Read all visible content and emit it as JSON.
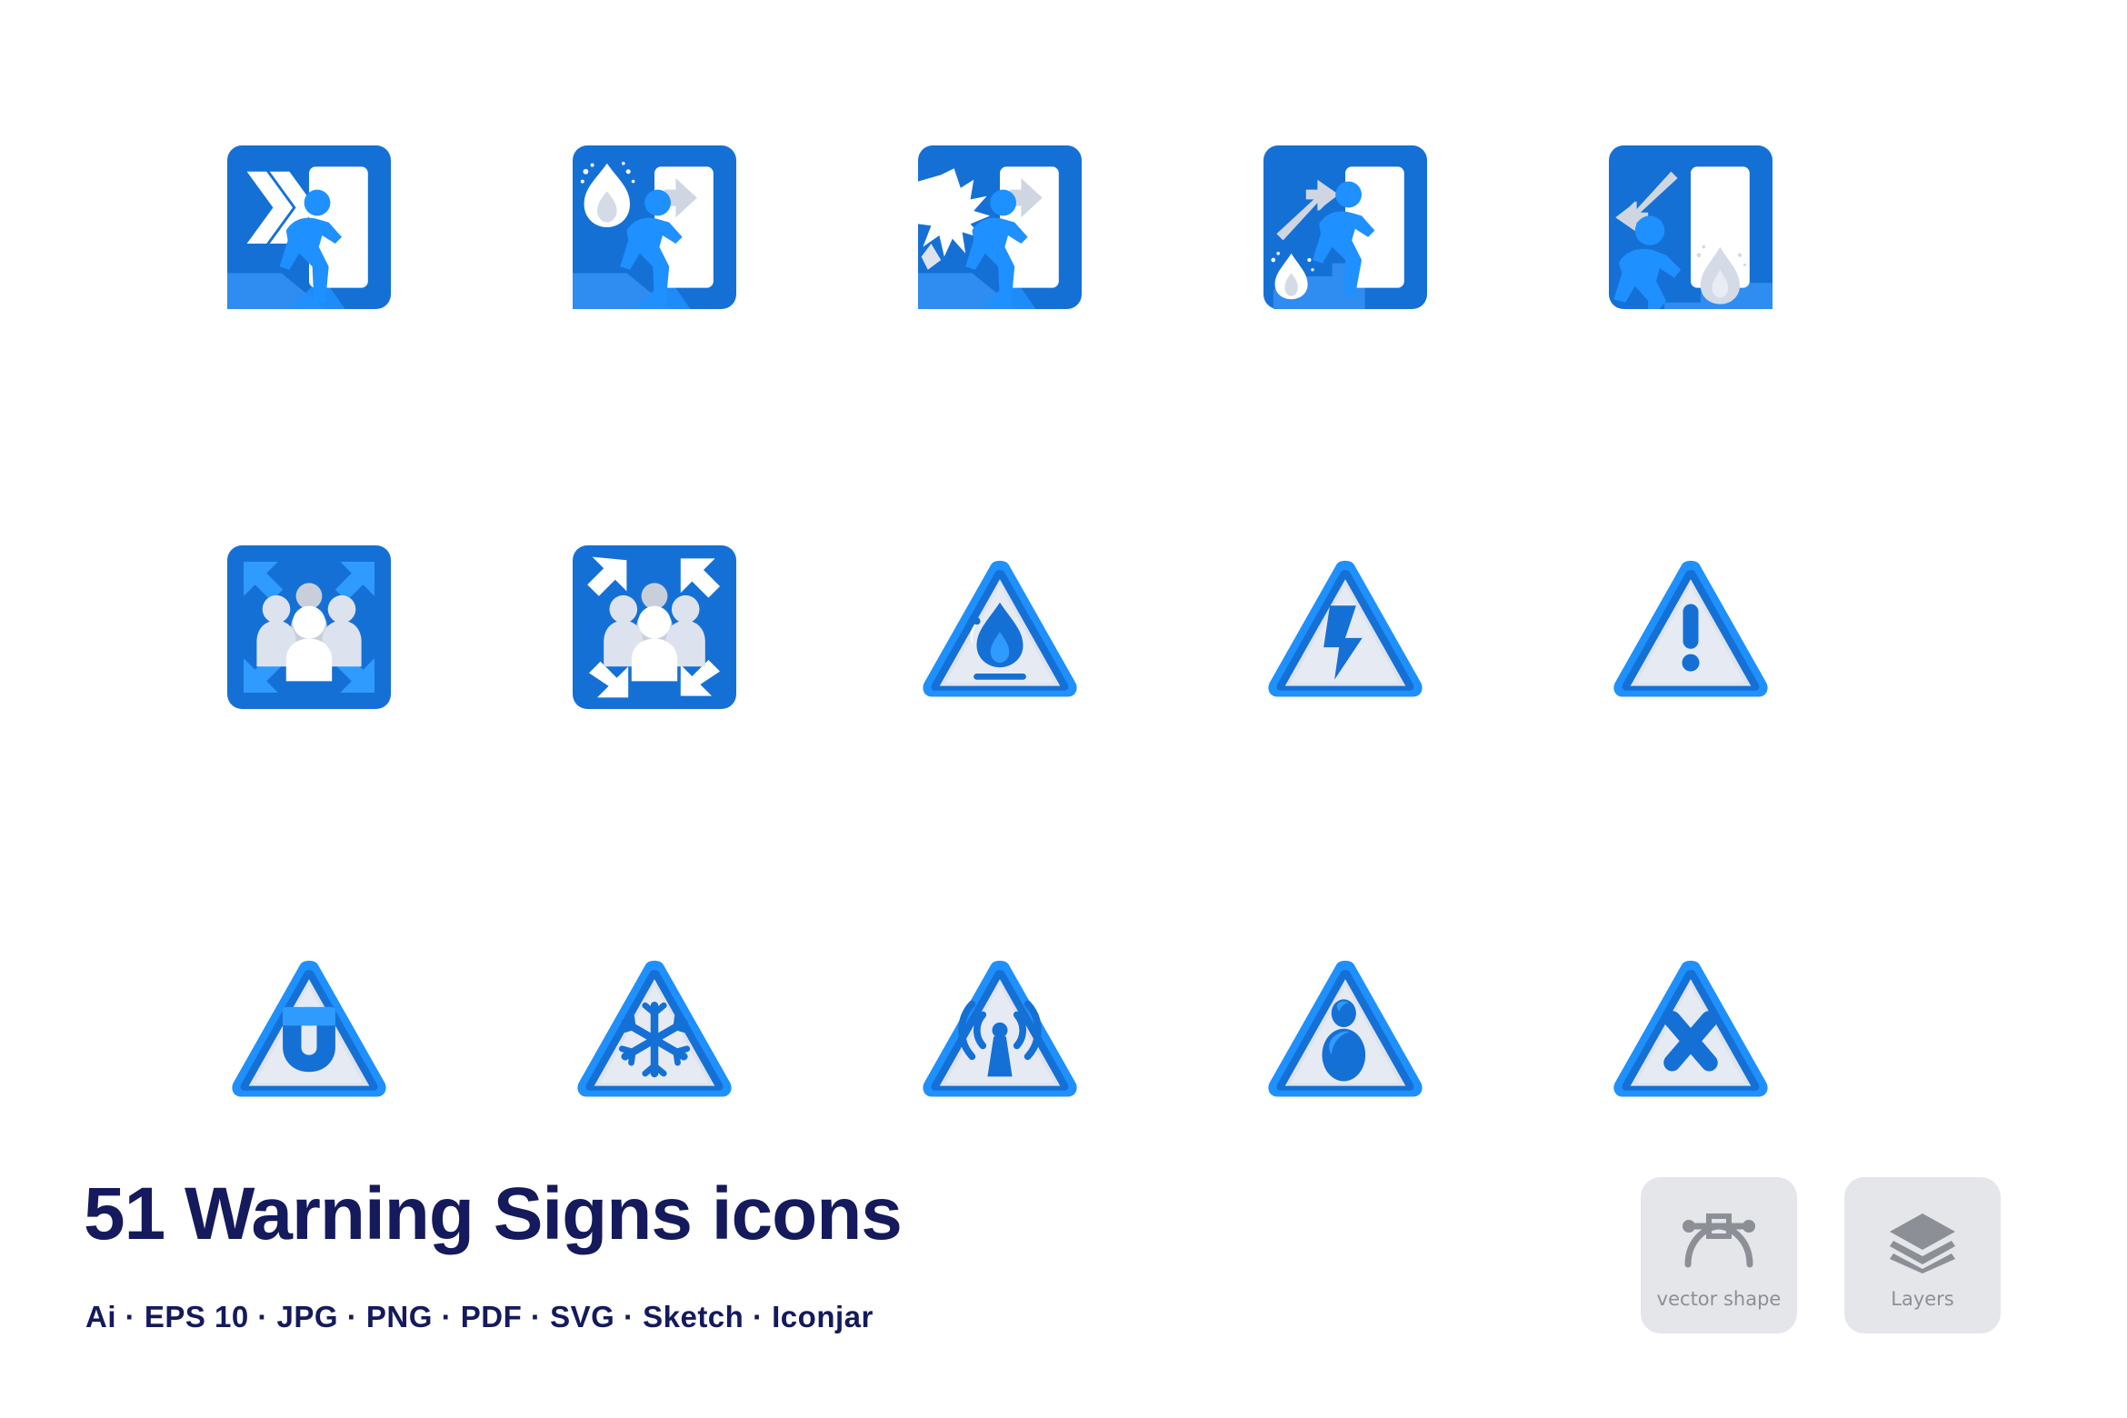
{
  "page": {
    "background_color": "#ffffff",
    "title": "51 Warning Signs icons",
    "subtitle": "Ai ·  EPS 10 · JPG · PNG · PDF · SVG · Sketch · Iconjar"
  },
  "colors": {
    "primary_blue": "#1570d6",
    "bright_blue": "#1e90ff",
    "light_blue": "#3ea0ff",
    "triangle_fill": "#dde3ee",
    "triangle_inner_stroke": "#c9d2e0",
    "white": "#ffffff",
    "pale_gray": "#d4dae6",
    "navy_text": "#141a5c",
    "badge_bg": "#e4e6ea",
    "badge_fg": "#8c8f96"
  },
  "icon_grid": {
    "columns": 5,
    "rows": 3,
    "icons": [
      {
        "id": "exit-chevrons",
        "shape": "rounded-square",
        "label": "Emergency exit right with double chevron arrows"
      },
      {
        "id": "fire-exit-right",
        "shape": "rounded-square",
        "label": "Fire exit right with flame"
      },
      {
        "id": "explosion-exit-right",
        "shape": "rounded-square",
        "label": "Explosion emergency exit right"
      },
      {
        "id": "fire-exit-stairs-up",
        "shape": "rounded-square",
        "label": "Fire exit stairs up right"
      },
      {
        "id": "fire-exit-stairs-down",
        "shape": "rounded-square",
        "label": "Fire exit stairs down left"
      },
      {
        "id": "assembly-point-out",
        "shape": "rounded-square",
        "label": "Assembly point arrows outward"
      },
      {
        "id": "assembly-point-in",
        "shape": "rounded-square",
        "label": "Assembly point arrows inward"
      },
      {
        "id": "warning-flammable",
        "shape": "triangle",
        "label": "Warning flammable material"
      },
      {
        "id": "warning-electricity",
        "shape": "triangle",
        "label": "Warning high voltage electricity"
      },
      {
        "id": "warning-general",
        "shape": "triangle",
        "label": "General warning exclamation mark"
      },
      {
        "id": "warning-magnetic",
        "shape": "triangle",
        "label": "Warning magnetic field"
      },
      {
        "id": "warning-low-temp",
        "shape": "triangle",
        "label": "Warning low temperature snowflake"
      },
      {
        "id": "warning-radio-waves",
        "shape": "triangle",
        "label": "Warning non-ionizing radiation"
      },
      {
        "id": "warning-biohazard",
        "shape": "triangle",
        "label": "Warning person hazard"
      },
      {
        "id": "warning-prohibited",
        "shape": "triangle",
        "label": "Warning cross prohibited"
      }
    ]
  },
  "badges": [
    {
      "id": "vector-shape",
      "icon": "pen-node-icon",
      "label": "vector shape"
    },
    {
      "id": "layers",
      "icon": "layers-icon",
      "label": "Layers"
    }
  ]
}
